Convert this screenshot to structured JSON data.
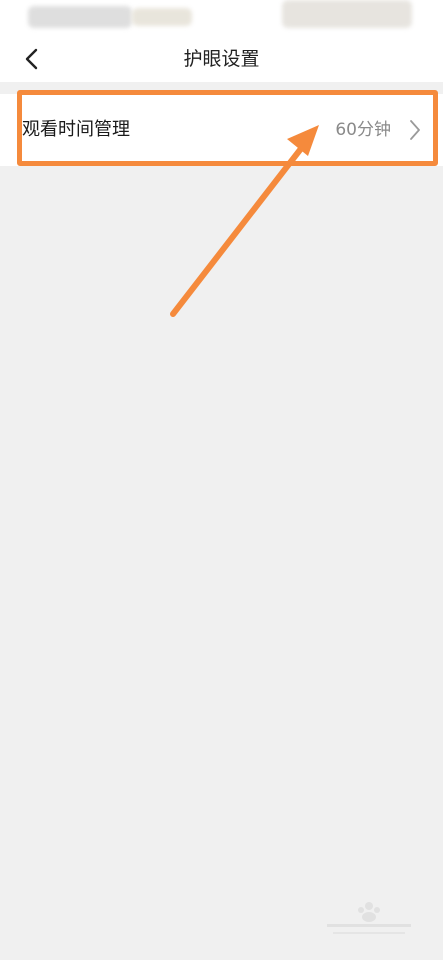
{
  "nav": {
    "title": "护眼设置"
  },
  "settings": {
    "items": [
      {
        "label": "观看时间管理",
        "value": "60分钟"
      }
    ]
  },
  "icons": {
    "back": "chevron-left-icon",
    "row_arrow": "chevron-right-icon"
  },
  "colors": {
    "annotation": "#f58a3c",
    "background": "#f0f0f0",
    "value_text": "#8a8a8a"
  }
}
